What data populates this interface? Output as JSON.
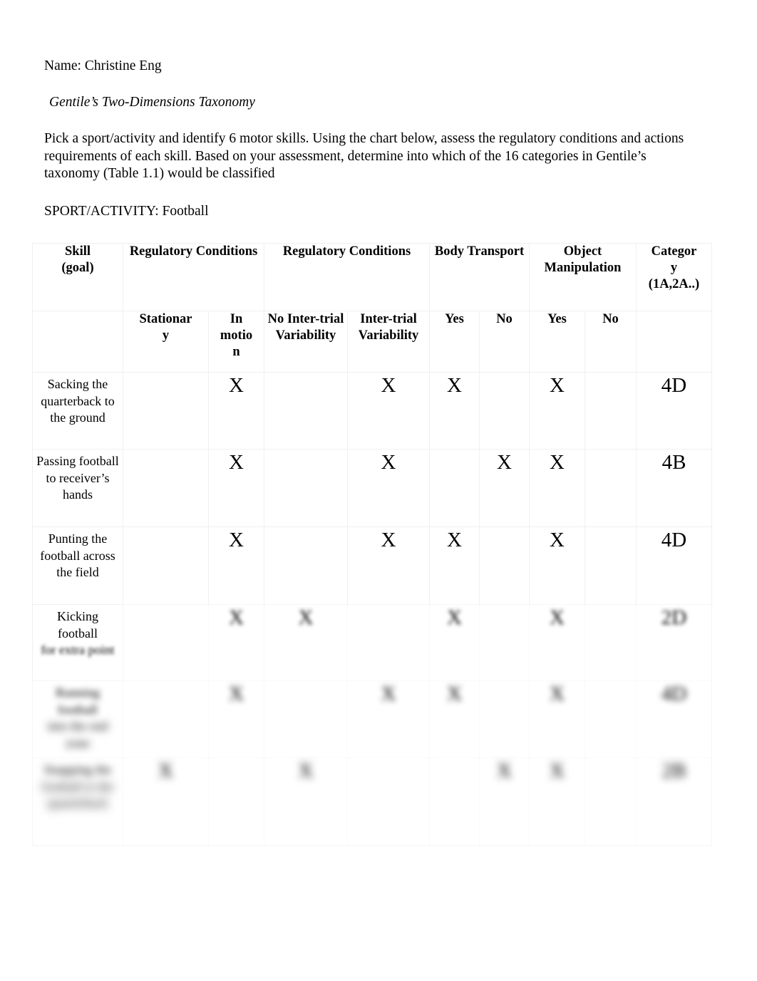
{
  "document": {
    "name_line": "Name: Christine Eng",
    "title": "Gentile’s Two-Dimensions Taxonomy",
    "instructions": "Pick a sport/activity and identify 6 motor skills. Using the chart below, assess the regulatory conditions and actions requirements of each skill. Based on your assessment, determine into which of the 16 categories in Gentile’s taxonomy (Table 1.1) would be classified",
    "sport_line": "SPORT/ACTIVITY: Football"
  },
  "table": {
    "header_top": {
      "skill": "Skill\n(goal)",
      "skill_line1": "Skill",
      "skill_line2": "(goal)",
      "regulatory_conditions_1": "Regulatory Conditions",
      "regulatory_conditions_2": "Regulatory Conditions",
      "body_transport": "Body Transport",
      "object_manipulation": "Object Manipulation",
      "category": "Category (1A,2A..)",
      "category_line1": "Categor",
      "category_line2": "y",
      "category_line3": "(1A,2A..)"
    },
    "header_sub": {
      "stationary": "Stationary",
      "stationary_line1": "Stationar",
      "stationary_line2": "y",
      "in_motion": "In motion",
      "in_motion_line1": "In",
      "in_motion_line2": "motio",
      "in_motion_line3": "n",
      "no_inter_trial_variability": "No Inter-trial Variability",
      "inter_trial_variability": "Inter-trial Variability",
      "bt_yes": "Yes",
      "bt_no": "No",
      "om_yes": "Yes",
      "om_no": "No",
      "category_blank": ""
    },
    "mark": "X",
    "rows": [
      {
        "skill": "Sacking the quarterback to the ground",
        "stationary": "",
        "in_motion": "X",
        "no_inter_trial": "",
        "inter_trial": "X",
        "bt_yes": "X",
        "bt_no": "",
        "om_yes": "X",
        "om_no": "",
        "category": "4D"
      },
      {
        "skill": "Passing football to receiver’s hands",
        "stationary": "",
        "in_motion": "X",
        "no_inter_trial": "",
        "inter_trial": "X",
        "bt_yes": "",
        "bt_no": "X",
        "om_yes": "X",
        "om_no": "",
        "category": "4B"
      },
      {
        "skill": "Punting the football across the field",
        "stationary": "",
        "in_motion": "X",
        "no_inter_trial": "",
        "inter_trial": "X",
        "bt_yes": "X",
        "bt_no": "",
        "om_yes": "X",
        "om_no": "",
        "category": "4D"
      },
      {
        "skill": "Kicking football",
        "skill_extra": "for extra point",
        "stationary": "",
        "in_motion": "X",
        "no_inter_trial": "X",
        "inter_trial": "",
        "bt_yes": "X",
        "bt_no": "",
        "om_yes": "X",
        "om_no": "",
        "category": "2D"
      },
      {
        "skill": "Running football",
        "skill_extra": "into the end zone",
        "stationary": "",
        "in_motion": "X",
        "no_inter_trial": "",
        "inter_trial": "X",
        "bt_yes": "X",
        "bt_no": "",
        "om_yes": "X",
        "om_no": "",
        "category": "4D"
      },
      {
        "skill": "Snapping the",
        "skill_extra": "football to the quarterback",
        "stationary": "X",
        "in_motion": "",
        "no_inter_trial": "X",
        "inter_trial": "",
        "bt_yes": "",
        "bt_no": "X",
        "om_yes": "X",
        "om_no": "",
        "category": "2B"
      }
    ]
  }
}
